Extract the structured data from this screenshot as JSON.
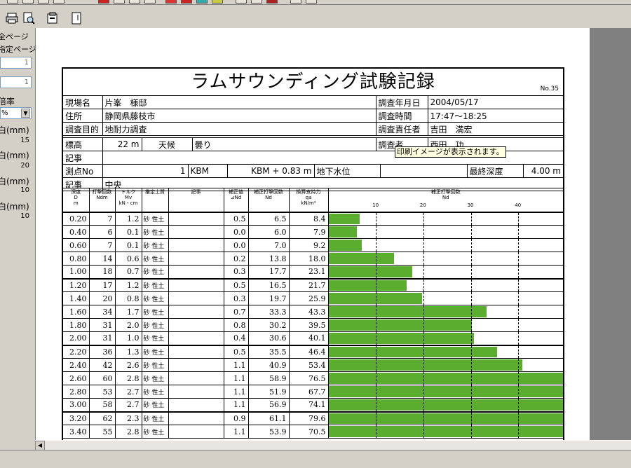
{
  "left_panel": {
    "all_pages": "全ページ",
    "specified_pages": "指定ページ",
    "page_from": "1",
    "page_to": "1",
    "zoom_label": "倍率",
    "zoom_value": "%",
    "margin_top_label": "白(mm)",
    "margin_top_value": "15",
    "margin_bottom_label": "白(mm)",
    "margin_bottom_value": "20",
    "margin_left_label": "白(mm)",
    "margin_left_value": "10",
    "margin_right_label": "白(mm)",
    "margin_right_value": "10"
  },
  "toolbar": {
    "icons": [
      "print-icon",
      "print-preview-icon",
      "page-setup-icon",
      "page-icon"
    ]
  },
  "report": {
    "title": "ラムサウンディング試験記録",
    "serial": "No.35",
    "site_name_label": "現場名",
    "site_name": "片峯　様邸",
    "survey_date_label": "調査年月日",
    "survey_date": "2004/05/17",
    "address_label": "住所",
    "address": "静岡県藤枝市",
    "survey_time_label": "調査時間",
    "survey_time": "17:47～18:25",
    "purpose_label": "調査目的",
    "purpose": "地耐力調査",
    "chief_label": "調査責任者",
    "chief": "吉田　満宏",
    "elevation_label": "標高",
    "elevation": "22 m",
    "weather_label": "天候",
    "weather": "曇り",
    "surveyor_label": "調査者",
    "surveyor": "西田　功",
    "note_label": "記事",
    "note": "",
    "point_label": "測点No",
    "point_no": "1",
    "kbm": "KBM",
    "kbm_value": "KBM + 0.83 m",
    "groundwater_label": "地下水位",
    "groundwater": "",
    "final_depth_label": "最終深度",
    "final_depth": "4.00 m",
    "note2_label": "記事",
    "note2": "中央",
    "tooltip": "印刷イメージが表示されます。"
  },
  "table": {
    "headers": {
      "depth": "深度\nD\nm",
      "blows": "打撃回数\nNdm",
      "torque": "トルク\nMv\nkN・cm",
      "soil": "推定土質",
      "remarks": "記事",
      "correction": "補正値\n⊿Nd",
      "nd": "補正打撃回数\nNd",
      "qa": "換算支持力\nqa\nkN/m²",
      "chart": "補正打撃回数\nNd"
    },
    "ticks": [
      "10",
      "20",
      "30",
      "40"
    ],
    "rows": [
      {
        "d": "0.20",
        "ndm": "7",
        "mv": "1.2",
        "soil": "砂 性土",
        "dnd": "0.5",
        "nd": "6.5",
        "qa": "8.4"
      },
      {
        "d": "0.40",
        "ndm": "6",
        "mv": "0.1",
        "soil": "砂 性土",
        "dnd": "0.0",
        "nd": "6.0",
        "qa": "7.9"
      },
      {
        "d": "0.60",
        "ndm": "7",
        "mv": "0.1",
        "soil": "砂 性土",
        "dnd": "0.0",
        "nd": "7.0",
        "qa": "9.2"
      },
      {
        "d": "0.80",
        "ndm": "14",
        "mv": "0.6",
        "soil": "砂 性土",
        "dnd": "0.2",
        "nd": "13.8",
        "qa": "18.0"
      },
      {
        "d": "1.00",
        "ndm": "18",
        "mv": "0.7",
        "soil": "砂 性土",
        "dnd": "0.3",
        "nd": "17.7",
        "qa": "23.1"
      },
      {
        "d": "1.20",
        "ndm": "17",
        "mv": "1.2",
        "soil": "砂 性土",
        "dnd": "0.5",
        "nd": "16.5",
        "qa": "21.7"
      },
      {
        "d": "1.40",
        "ndm": "20",
        "mv": "0.8",
        "soil": "砂 性土",
        "dnd": "0.3",
        "nd": "19.7",
        "qa": "25.9"
      },
      {
        "d": "1.60",
        "ndm": "34",
        "mv": "1.7",
        "soil": "砂 性土",
        "dnd": "0.7",
        "nd": "33.3",
        "qa": "43.3"
      },
      {
        "d": "1.80",
        "ndm": "31",
        "mv": "2.0",
        "soil": "砂 性土",
        "dnd": "0.8",
        "nd": "30.2",
        "qa": "39.5"
      },
      {
        "d": "2.00",
        "ndm": "31",
        "mv": "1.0",
        "soil": "砂 性土",
        "dnd": "0.4",
        "nd": "30.6",
        "qa": "40.1"
      },
      {
        "d": "2.20",
        "ndm": "36",
        "mv": "1.3",
        "soil": "砂 性土",
        "dnd": "0.5",
        "nd": "35.5",
        "qa": "46.4"
      },
      {
        "d": "2.40",
        "ndm": "42",
        "mv": "2.6",
        "soil": "砂 性土",
        "dnd": "1.1",
        "nd": "40.9",
        "qa": "53.4"
      },
      {
        "d": "2.60",
        "ndm": "60",
        "mv": "2.8",
        "soil": "砂 性土",
        "dnd": "1.1",
        "nd": "58.9",
        "qa": "76.5"
      },
      {
        "d": "2.80",
        "ndm": "53",
        "mv": "2.7",
        "soil": "砂 性土",
        "dnd": "1.1",
        "nd": "51.9",
        "qa": "67.7"
      },
      {
        "d": "3.00",
        "ndm": "58",
        "mv": "2.7",
        "soil": "砂 性土",
        "dnd": "1.1",
        "nd": "56.9",
        "qa": "74.1"
      },
      {
        "d": "3.20",
        "ndm": "62",
        "mv": "2.3",
        "soil": "砂 性土",
        "dnd": "0.9",
        "nd": "61.1",
        "qa": "79.6"
      },
      {
        "d": "3.40",
        "ndm": "55",
        "mv": "2.8",
        "soil": "砂 性土",
        "dnd": "1.1",
        "nd": "53.9",
        "qa": "70.5"
      }
    ]
  },
  "chart_data": {
    "type": "bar",
    "orientation": "horizontal",
    "categories": [
      "0.20",
      "0.40",
      "0.60",
      "0.80",
      "1.00",
      "1.20",
      "1.40",
      "1.60",
      "1.80",
      "2.00",
      "2.20",
      "2.40",
      "2.60",
      "2.80",
      "3.00",
      "3.20",
      "3.40"
    ],
    "values": [
      6.5,
      6.0,
      7.0,
      13.8,
      17.7,
      16.5,
      19.7,
      33.3,
      30.2,
      30.6,
      35.5,
      40.9,
      58.9,
      51.9,
      56.9,
      61.1,
      53.9
    ],
    "xlim": [
      0,
      50
    ],
    "ticks": [
      10,
      20,
      30,
      40
    ],
    "color": "#5aad2e",
    "title": "補正打撃回数 Nd"
  }
}
